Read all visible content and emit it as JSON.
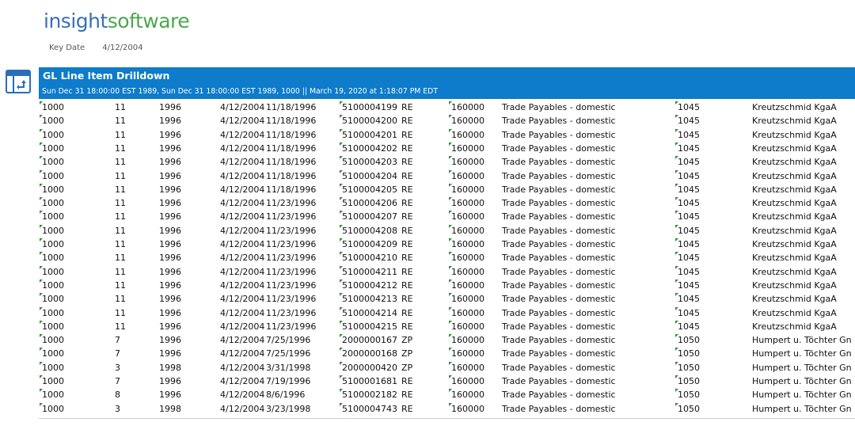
{
  "header": {
    "logo_part1": "insight",
    "logo_part2": "software",
    "key_date_label": "Key Date",
    "key_date_value": "4/12/2004"
  },
  "report": {
    "title": "GL Line Item Drilldown",
    "subtitle": "Sun Dec 31 18:00:00 EST 1989, Sun Dec 31 18:00:00 EST 1989, 1000 || March 19, 2020 at 1:18:07 PM EDT",
    "icon": "report-drilldown-icon"
  },
  "colors": {
    "banner": "#0e7bcb",
    "logo_blue": "#3a6fb6",
    "logo_green": "#4aa850",
    "indicator": "#2f8f2f"
  },
  "rows": [
    [
      "1000",
      "11",
      "1996",
      "4/12/2004",
      "11/18/1996",
      "5100004199",
      "RE",
      "160000",
      "Trade Payables - domestic",
      "1045",
      "Kreutzschmid KgaA"
    ],
    [
      "1000",
      "11",
      "1996",
      "4/12/2004",
      "11/18/1996",
      "5100004200",
      "RE",
      "160000",
      "Trade Payables - domestic",
      "1045",
      "Kreutzschmid KgaA"
    ],
    [
      "1000",
      "11",
      "1996",
      "4/12/2004",
      "11/18/1996",
      "5100004201",
      "RE",
      "160000",
      "Trade Payables - domestic",
      "1045",
      "Kreutzschmid KgaA"
    ],
    [
      "1000",
      "11",
      "1996",
      "4/12/2004",
      "11/18/1996",
      "5100004202",
      "RE",
      "160000",
      "Trade Payables - domestic",
      "1045",
      "Kreutzschmid KgaA"
    ],
    [
      "1000",
      "11",
      "1996",
      "4/12/2004",
      "11/18/1996",
      "5100004203",
      "RE",
      "160000",
      "Trade Payables - domestic",
      "1045",
      "Kreutzschmid KgaA"
    ],
    [
      "1000",
      "11",
      "1996",
      "4/12/2004",
      "11/18/1996",
      "5100004204",
      "RE",
      "160000",
      "Trade Payables - domestic",
      "1045",
      "Kreutzschmid KgaA"
    ],
    [
      "1000",
      "11",
      "1996",
      "4/12/2004",
      "11/18/1996",
      "5100004205",
      "RE",
      "160000",
      "Trade Payables - domestic",
      "1045",
      "Kreutzschmid KgaA"
    ],
    [
      "1000",
      "11",
      "1996",
      "4/12/2004",
      "11/23/1996",
      "5100004206",
      "RE",
      "160000",
      "Trade Payables - domestic",
      "1045",
      "Kreutzschmid KgaA"
    ],
    [
      "1000",
      "11",
      "1996",
      "4/12/2004",
      "11/23/1996",
      "5100004207",
      "RE",
      "160000",
      "Trade Payables - domestic",
      "1045",
      "Kreutzschmid KgaA"
    ],
    [
      "1000",
      "11",
      "1996",
      "4/12/2004",
      "11/23/1996",
      "5100004208",
      "RE",
      "160000",
      "Trade Payables - domestic",
      "1045",
      "Kreutzschmid KgaA"
    ],
    [
      "1000",
      "11",
      "1996",
      "4/12/2004",
      "11/23/1996",
      "5100004209",
      "RE",
      "160000",
      "Trade Payables - domestic",
      "1045",
      "Kreutzschmid KgaA"
    ],
    [
      "1000",
      "11",
      "1996",
      "4/12/2004",
      "11/23/1996",
      "5100004210",
      "RE",
      "160000",
      "Trade Payables - domestic",
      "1045",
      "Kreutzschmid KgaA"
    ],
    [
      "1000",
      "11",
      "1996",
      "4/12/2004",
      "11/23/1996",
      "5100004211",
      "RE",
      "160000",
      "Trade Payables - domestic",
      "1045",
      "Kreutzschmid KgaA"
    ],
    [
      "1000",
      "11",
      "1996",
      "4/12/2004",
      "11/23/1996",
      "5100004212",
      "RE",
      "160000",
      "Trade Payables - domestic",
      "1045",
      "Kreutzschmid KgaA"
    ],
    [
      "1000",
      "11",
      "1996",
      "4/12/2004",
      "11/23/1996",
      "5100004213",
      "RE",
      "160000",
      "Trade Payables - domestic",
      "1045",
      "Kreutzschmid KgaA"
    ],
    [
      "1000",
      "11",
      "1996",
      "4/12/2004",
      "11/23/1996",
      "5100004214",
      "RE",
      "160000",
      "Trade Payables - domestic",
      "1045",
      "Kreutzschmid KgaA"
    ],
    [
      "1000",
      "11",
      "1996",
      "4/12/2004",
      "11/23/1996",
      "5100004215",
      "RE",
      "160000",
      "Trade Payables - domestic",
      "1045",
      "Kreutzschmid KgaA"
    ],
    [
      "1000",
      "7",
      "1996",
      "4/12/2004",
      "7/25/1996",
      "2000000167",
      "ZP",
      "160000",
      "Trade Payables - domestic",
      "1050",
      "Humpert u. Töchter Gn"
    ],
    [
      "1000",
      "7",
      "1996",
      "4/12/2004",
      "7/25/1996",
      "2000000168",
      "ZP",
      "160000",
      "Trade Payables - domestic",
      "1050",
      "Humpert u. Töchter Gn"
    ],
    [
      "1000",
      "3",
      "1998",
      "4/12/2004",
      "3/31/1998",
      "2000000420",
      "ZP",
      "160000",
      "Trade Payables - domestic",
      "1050",
      "Humpert u. Töchter Gn"
    ],
    [
      "1000",
      "7",
      "1996",
      "4/12/2004",
      "7/19/1996",
      "5100001681",
      "RE",
      "160000",
      "Trade Payables - domestic",
      "1050",
      "Humpert u. Töchter Gn"
    ],
    [
      "1000",
      "8",
      "1996",
      "4/12/2004",
      "8/6/1996",
      "5100002182",
      "RE",
      "160000",
      "Trade Payables - domestic",
      "1050",
      "Humpert u. Töchter Gn"
    ],
    [
      "1000",
      "3",
      "1998",
      "4/12/2004",
      "3/23/1998",
      "5100004743",
      "RE",
      "160000",
      "Trade Payables - domestic",
      "1050",
      "Humpert u. Töchter Gn"
    ]
  ]
}
